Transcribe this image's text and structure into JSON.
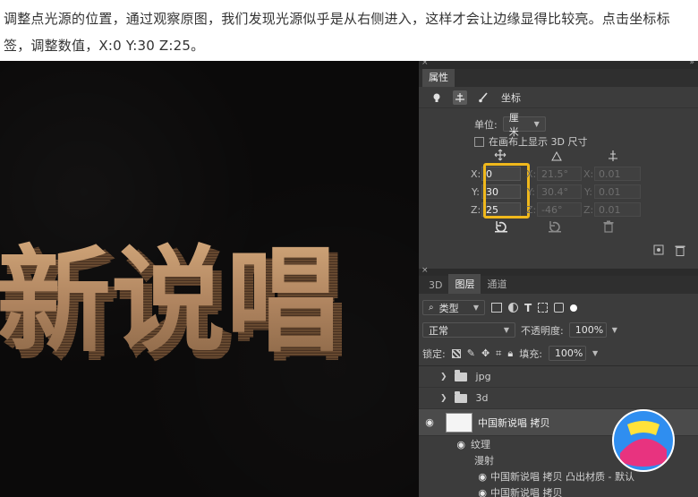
{
  "caption": "调整点光源的位置，通过观察原图，我们发现光源似乎是从右侧进入，这样才会让边缘显得比较亮。点击坐标标签，调整数值，X:0 Y:30 Z:25。",
  "artwork": {
    "text": "新说唱",
    "color": "#b08560"
  },
  "properties": {
    "tab": "属性",
    "tools": [
      "light-bulb-icon",
      "coordinate-icon",
      "brush-icon"
    ],
    "title": "坐标",
    "unit_label": "单位:",
    "unit_value": "厘米",
    "show_3d_label": "在画布上显示 3D 尺寸",
    "position": {
      "x_label": "X:",
      "y_label": "Y:",
      "z_label": "Z:",
      "x": "0",
      "y": "30",
      "z": "25"
    },
    "rotation": {
      "x": "21.5°",
      "y": "30.4°",
      "z": "-46°",
      "x_label": "X:",
      "y_label": "Y:",
      "z_label": "Z:"
    },
    "scale": {
      "x": "0.01",
      "y": "0.01",
      "z": "0.01",
      "x_label": "X:",
      "y_label": "Y:",
      "z_label": "Z:"
    },
    "accent": "#f0b81c"
  },
  "layers": {
    "tabs": [
      "3D",
      "图层",
      "通道"
    ],
    "active_tab": "图层",
    "filter_label": "类型",
    "blend_mode": "正常",
    "opacity_label": "不透明度:",
    "opacity_value": "100%",
    "lock_label": "锁定:",
    "fill_label": "填充:",
    "fill_value": "100%",
    "items": [
      {
        "name": "jpg",
        "kind": "folder"
      },
      {
        "name": "3d",
        "kind": "folder"
      },
      {
        "name": "中国新说唱 拷贝",
        "kind": "3d-layer"
      },
      {
        "name": "纹理",
        "kind": "sub"
      },
      {
        "name": "漫射",
        "kind": "sub"
      },
      {
        "name": "中国新说唱 拷贝 凸出材质 - 默认",
        "kind": "texture"
      },
      {
        "name": "中国新说唱 拷贝",
        "kind": "texture"
      }
    ]
  }
}
